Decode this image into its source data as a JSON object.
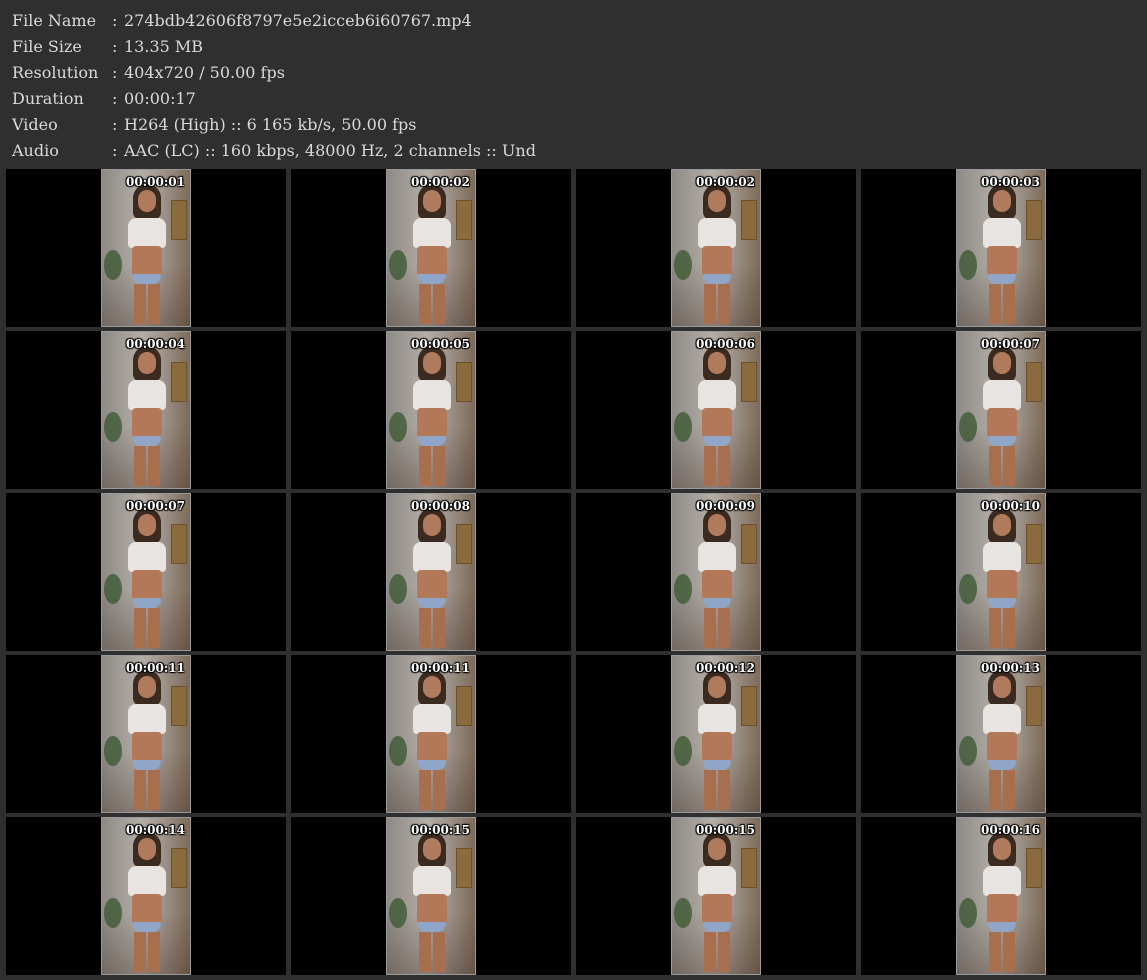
{
  "info": [
    {
      "label": "File Name",
      "value": "274bdb42606f8797e5e2icceb6i60767.mp4"
    },
    {
      "label": "File Size",
      "value": "13.35 MB"
    },
    {
      "label": "Resolution",
      "value": "404x720 / 50.00 fps"
    },
    {
      "label": "Duration",
      "value": "00:00:17"
    },
    {
      "label": "Video",
      "value": "H264 (High) :: 6 165 kb/s, 50.00 fps"
    },
    {
      "label": "Audio",
      "value": "AAC (LC) :: 160 kbps, 48000 Hz, 2 channels :: Und"
    }
  ],
  "separator": ":",
  "thumbnails": [
    "00:00:01",
    "00:00:02",
    "00:00:02",
    "00:00:03",
    "00:00:04",
    "00:00:05",
    "00:00:06",
    "00:00:07",
    "00:00:07",
    "00:00:08",
    "00:00:09",
    "00:00:10",
    "00:00:11",
    "00:00:11",
    "00:00:12",
    "00:00:13",
    "00:00:14",
    "00:00:15",
    "00:00:15",
    "00:00:16"
  ],
  "colors": {
    "background": "#2f2f2f",
    "text": "#d9d9d9",
    "cell_background": "#000000",
    "timestamp": "#ffffff"
  }
}
